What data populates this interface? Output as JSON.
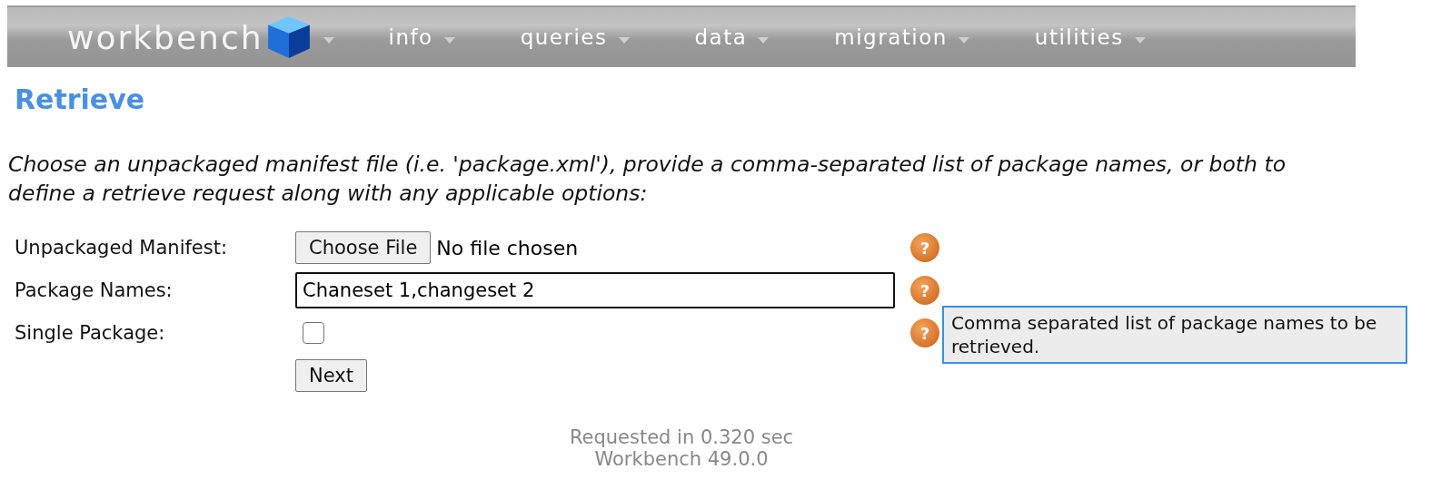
{
  "nav": {
    "logo": "workbench",
    "items": [
      {
        "label": "info"
      },
      {
        "label": "queries"
      },
      {
        "label": "data"
      },
      {
        "label": "migration"
      },
      {
        "label": "utilities"
      }
    ]
  },
  "title": "Retrieve",
  "description": "Choose an unpackaged manifest file (i.e. 'package.xml'), provide a comma-separated list of package names, or both to define a retrieve request along with any applicable options:",
  "form": [
    {
      "kind": "file",
      "label": "Unpackaged Manifest:",
      "button": "Choose File",
      "status": "No file chosen",
      "help": "?"
    },
    {
      "kind": "text",
      "label": "Package Names:",
      "value": "Chaneset 1,changeset 2",
      "help": "?"
    },
    {
      "kind": "checkbox",
      "label": "Single Package:",
      "checked": false,
      "help": "?"
    }
  ],
  "tooltip": "Comma separated list of package names to be retrieved.",
  "submit": "Next",
  "footer": [
    "Requested in 0.320 sec",
    "Workbench 49.0.0"
  ]
}
